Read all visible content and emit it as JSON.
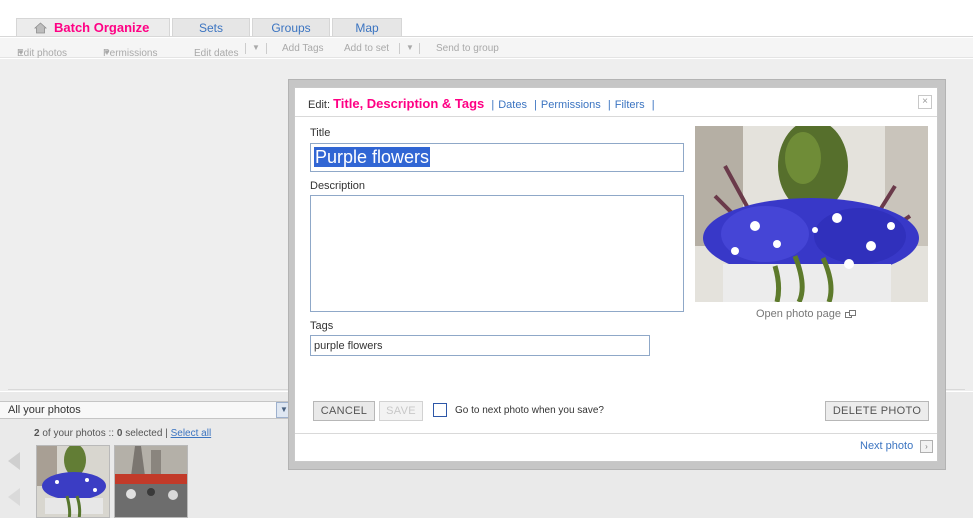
{
  "tabs": [
    {
      "label": "Batch Organize",
      "active": true
    },
    {
      "label": "Sets",
      "active": false
    },
    {
      "label": "Groups",
      "active": false
    },
    {
      "label": "Map",
      "active": false
    }
  ],
  "toolbar": {
    "edit_photos": "Edit photos",
    "permissions": "Permissions",
    "edit_dates": "Edit dates",
    "add_tags": "Add Tags",
    "add_to_set": "Add to set",
    "send_to_group": "Send to group",
    "dropdown_arrow": "▼"
  },
  "modal": {
    "edit_prefix": "Edit:",
    "current_section": "Title, Description & Tags",
    "links": [
      "Dates",
      "Permissions",
      "Filters"
    ],
    "pipe": "|",
    "close_glyph": "×",
    "title_label": "Title",
    "title_value": "Purple flowers",
    "description_label": "Description",
    "description_value": "",
    "tags_label": "Tags",
    "tags_value": "purple flowers",
    "open_photo_page": "Open photo page",
    "cancel": "CANCEL",
    "save": "SAVE",
    "go_next_label": "Go to next photo when you save?",
    "go_next_checked": false,
    "delete": "DELETE PHOTO",
    "next_photo": "Next photo",
    "next_glyph": "›"
  },
  "filmstrip": {
    "filter_value": "All your photos",
    "filter_arrow": "▼",
    "count_total": "2",
    "count_mid": "of your photos ::",
    "count_selected": "0",
    "count_suffix": "selected |",
    "select_all": "Select all"
  },
  "colors": {
    "brand_pink": "#ff0084",
    "link_blue": "#3b74c1"
  }
}
